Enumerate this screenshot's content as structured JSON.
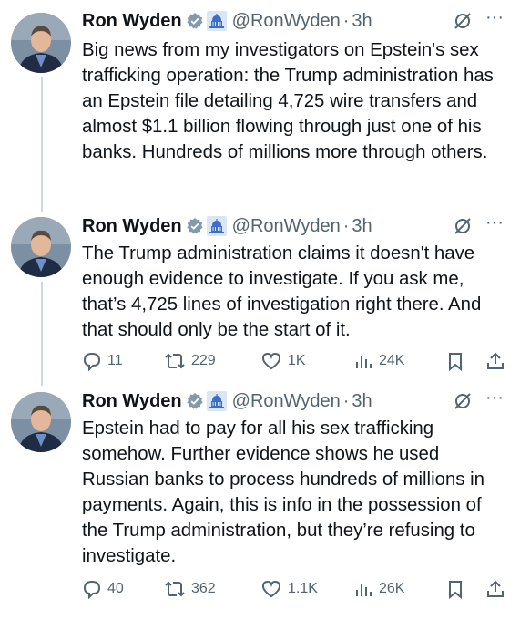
{
  "tweets": [
    {
      "author_name": "Ron Wyden",
      "handle": "@RonWyden",
      "separator": "·",
      "time": "3h",
      "more": "···",
      "text": "Big news from my investigators on Epstein's sex trafficking operation: the Trump administration has an Epstein file detailing 4,725 wire transfers and almost $1.1 billion flowing through just one of his banks. Hundreds of millions more through others."
    },
    {
      "author_name": "Ron Wyden",
      "handle": "@RonWyden",
      "separator": "·",
      "time": "3h",
      "more": "···",
      "text": "The Trump administration claims it doesn't have enough evidence to investigate. If you ask me, that’s 4,725 lines of investigation right there. And that should only be the start of it.",
      "replies": "11",
      "reposts": "229",
      "likes": "1K",
      "views": "24K"
    },
    {
      "author_name": "Ron Wyden",
      "handle": "@RonWyden",
      "separator": "·",
      "time": "3h",
      "more": "···",
      "text": "Epstein had to pay for all his sex trafficking somehow. Further evidence shows he used Russian banks to process hundreds of millions in payments. Again, this is info in the possession of the Trump administration, but they’re refusing to investigate.",
      "replies": "40",
      "reposts": "362",
      "likes": "1.1K",
      "views": "26K"
    }
  ],
  "colors": {
    "text": "#0f1419",
    "secondary": "#536471",
    "verified": "#829aab",
    "thread_line": "#cfd9de"
  },
  "icons": [
    "verified-badge-icon",
    "government-building-icon",
    "grok-icon",
    "more-icon",
    "reply-icon",
    "repost-icon",
    "like-icon",
    "views-icon",
    "bookmark-icon",
    "share-icon"
  ]
}
